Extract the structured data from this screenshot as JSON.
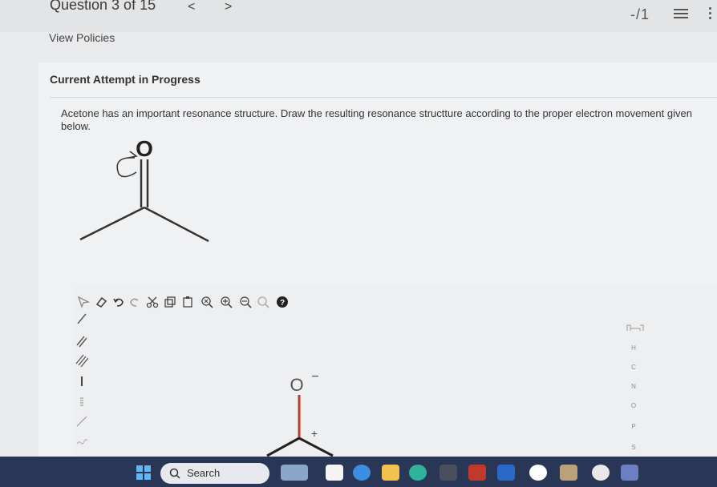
{
  "header": {
    "question_label": "Question 3 of 15",
    "prev_glyph": "<",
    "next_glyph": ">",
    "score": "-/1",
    "view_policies": "View Policies"
  },
  "main": {
    "attempt_label": "Current Attempt in Progress",
    "prompt": "Acetone has an important resonance structure. Draw the resulting resonance structture according to the proper electron movement given below.",
    "given_atom": "O"
  },
  "editor": {
    "canvas_atom": "O",
    "canvas_charge": "−",
    "plus_sign": "+",
    "elements": [
      "H",
      "C",
      "N",
      "O",
      "P",
      "S"
    ]
  },
  "taskbar": {
    "search_label": "Search"
  },
  "colors": {
    "page_bg": "#e9eaec",
    "taskbar_bg": "#2a3655",
    "accent_red": "#c0392b"
  }
}
